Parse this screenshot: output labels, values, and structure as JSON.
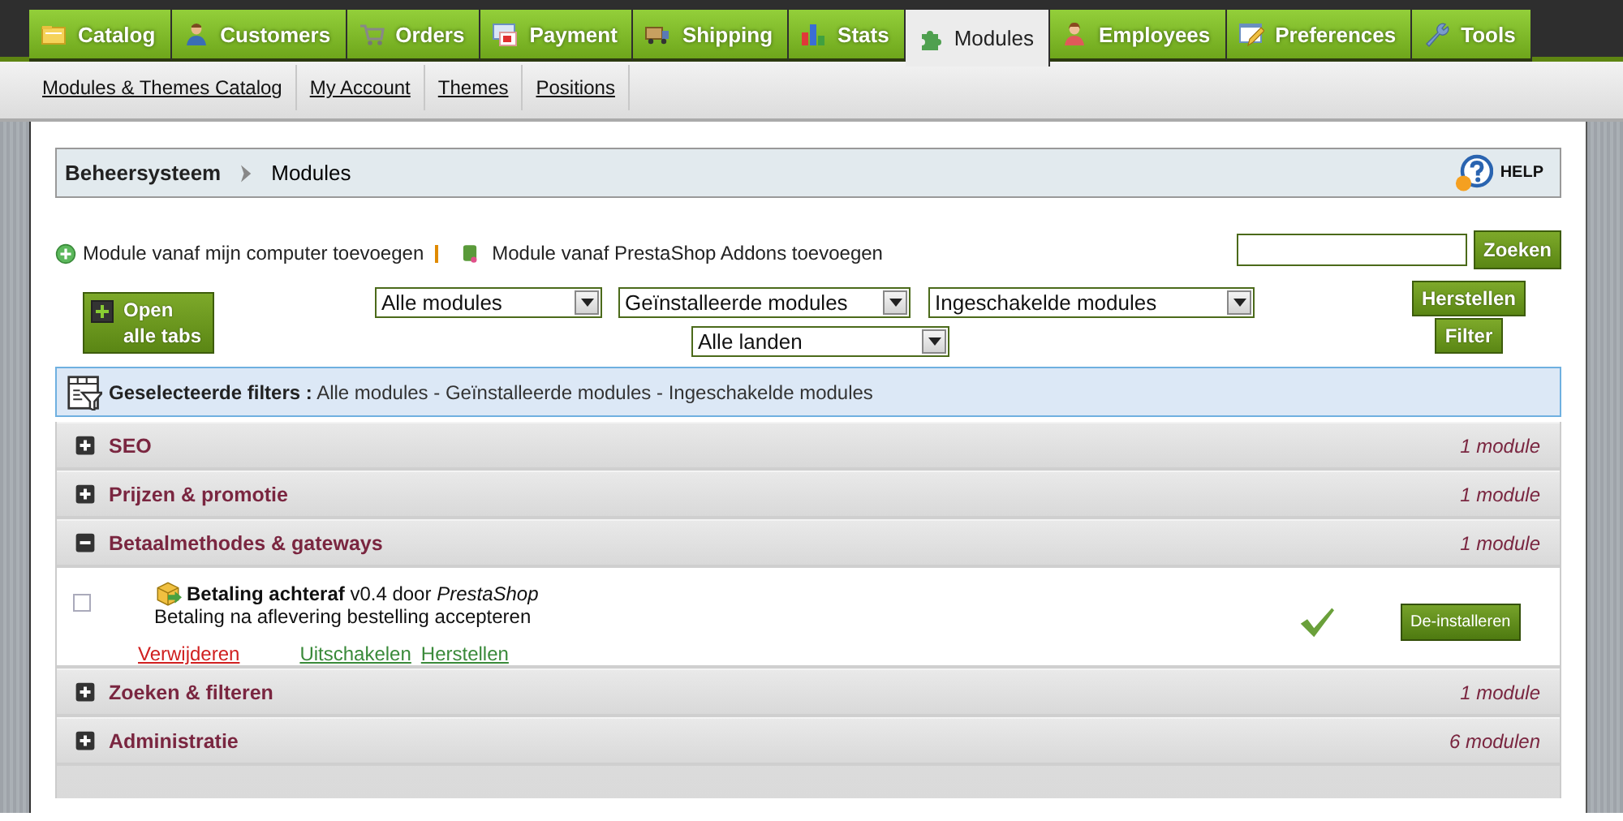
{
  "main_tabs": [
    {
      "label": "Catalog",
      "selected": false
    },
    {
      "label": "Customers",
      "selected": false
    },
    {
      "label": "Orders",
      "selected": false
    },
    {
      "label": "Payment",
      "selected": false
    },
    {
      "label": "Shipping",
      "selected": false
    },
    {
      "label": "Stats",
      "selected": false
    },
    {
      "label": "Modules",
      "selected": true
    },
    {
      "label": "Employees",
      "selected": false
    },
    {
      "label": "Preferences",
      "selected": false
    },
    {
      "label": "Tools",
      "selected": false
    }
  ],
  "sub_nav": [
    "Modules & Themes Catalog",
    "My Account",
    "Themes",
    "Positions"
  ],
  "breadcrumb": {
    "root": "Beheersysteem",
    "current": "Modules",
    "help": "HELP"
  },
  "add_links": [
    "Module vanaf mijn computer toevoegen",
    "Module vanaf PrestaShop Addons toevoegen"
  ],
  "search": {
    "button": "Zoeken"
  },
  "open_all_button": "Open alle tabs",
  "filter_selects": [
    {
      "value": "Alle modules"
    },
    {
      "value": "Geïnstalleerde modules"
    },
    {
      "value": "Ingeschakelde modules"
    },
    {
      "value": "Alle landen"
    }
  ],
  "reset_button": "Herstellen",
  "filter_button": "Filter",
  "selected_filters": {
    "label": "Geselecteerde filters :",
    "value": "Alle modules - Geïnstalleerde modules - Ingeschakelde modules"
  },
  "categories": [
    {
      "name": "SEO",
      "count": "1 module",
      "expanded": false
    },
    {
      "name": "Prijzen & promotie",
      "count": "1 module",
      "expanded": false
    },
    {
      "name": "Betaalmethodes & gateways",
      "count": "1 module",
      "expanded": true,
      "modules": [
        {
          "title": "**Betaling achteraf** v0.4 door *PrestaShop*",
          "description": "Betaling na aflevering bestelling accepteren",
          "checked": false,
          "installed": true,
          "actions": [
            {
              "label": "Verwijderen",
              "kind": "danger"
            },
            {
              "label": "Uitschakelen",
              "kind": "normal"
            },
            {
              "label": "Herstellen",
              "kind": "normal"
            }
          ],
          "button": "De-installeren"
        }
      ]
    },
    {
      "name": "Zoeken & filteren",
      "count": "1 module",
      "expanded": false
    },
    {
      "name": "Administratie",
      "count": "6 modulen",
      "expanded": false
    }
  ]
}
